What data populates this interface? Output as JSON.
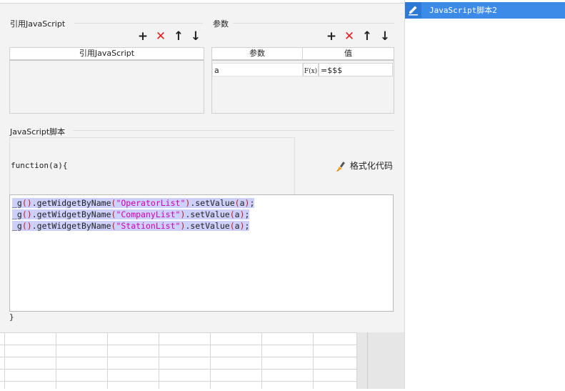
{
  "reference_section": {
    "title": "引用JavaScript",
    "column_header": "引用JavaScript",
    "rows": []
  },
  "params_section": {
    "title": "参数",
    "columns": [
      "参数",
      "值"
    ],
    "rows": [
      {
        "name": "a",
        "formula_icon": "F(x)",
        "value": "=$$$"
      }
    ]
  },
  "toolbar_icons": [
    "add-icon",
    "delete-icon",
    "move-up-icon",
    "move-down-icon"
  ],
  "script_section": {
    "title": "JavaScript脚本",
    "function_header": "function(a){",
    "format_button": "格式化代码",
    "closing": "}",
    "code_lines": [
      {
        "prefix": "_g",
        "p1": "()",
        "mid": ".getWidgetByName",
        "p2": "(",
        "str": "\"OperatorList\"",
        "p3": ")",
        "call": ".setValue",
        "p4": "(",
        "arg": "a",
        "p5": ")",
        "end": ";"
      },
      {
        "prefix": "_g",
        "p1": "()",
        "mid": ".getWidgetByName",
        "p2": "(",
        "str": "\"CompanyList\"",
        "p3": ")",
        "call": ".setValue",
        "p4": "(",
        "arg": "a",
        "p5": ")",
        "end": ";"
      },
      {
        "prefix": "_g",
        "p1": "()",
        "mid": ".getWidgetByName",
        "p2": "(",
        "str": "\"StationList\"",
        "p3": ")",
        "call": ".setValue",
        "p4": "(",
        "arg": "a",
        "p5": ")",
        "end": ";"
      }
    ]
  },
  "sidebar": {
    "items": [
      {
        "label": "JavaScript脚本2",
        "icon": "pencil-icon",
        "selected": true
      }
    ]
  },
  "colors": {
    "accent": "#3d8be8",
    "delete": "#e02020",
    "selection": "#cdd0fb",
    "string": "#d000b0",
    "paren": "#c01818"
  }
}
